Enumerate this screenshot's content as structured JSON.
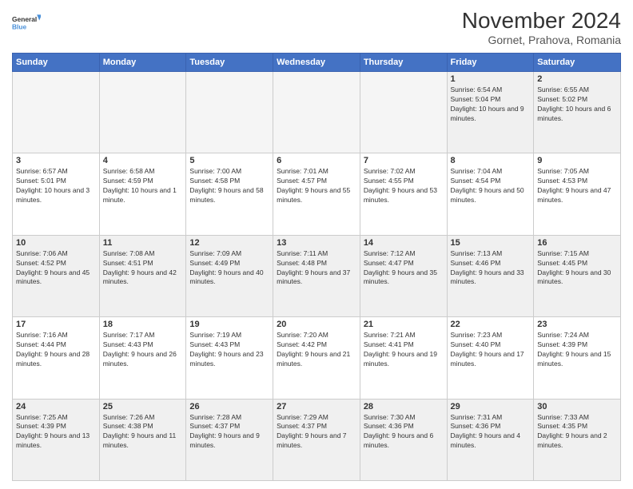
{
  "logo": {
    "general": "General",
    "blue": "Blue"
  },
  "header": {
    "month": "November 2024",
    "location": "Gornet, Prahova, Romania"
  },
  "weekdays": [
    "Sunday",
    "Monday",
    "Tuesday",
    "Wednesday",
    "Thursday",
    "Friday",
    "Saturday"
  ],
  "weeks": [
    [
      {
        "day": "",
        "info": ""
      },
      {
        "day": "",
        "info": ""
      },
      {
        "day": "",
        "info": ""
      },
      {
        "day": "",
        "info": ""
      },
      {
        "day": "",
        "info": ""
      },
      {
        "day": "1",
        "info": "Sunrise: 6:54 AM\nSunset: 5:04 PM\nDaylight: 10 hours and 9 minutes."
      },
      {
        "day": "2",
        "info": "Sunrise: 6:55 AM\nSunset: 5:02 PM\nDaylight: 10 hours and 6 minutes."
      }
    ],
    [
      {
        "day": "3",
        "info": "Sunrise: 6:57 AM\nSunset: 5:01 PM\nDaylight: 10 hours and 3 minutes."
      },
      {
        "day": "4",
        "info": "Sunrise: 6:58 AM\nSunset: 4:59 PM\nDaylight: 10 hours and 1 minute."
      },
      {
        "day": "5",
        "info": "Sunrise: 7:00 AM\nSunset: 4:58 PM\nDaylight: 9 hours and 58 minutes."
      },
      {
        "day": "6",
        "info": "Sunrise: 7:01 AM\nSunset: 4:57 PM\nDaylight: 9 hours and 55 minutes."
      },
      {
        "day": "7",
        "info": "Sunrise: 7:02 AM\nSunset: 4:55 PM\nDaylight: 9 hours and 53 minutes."
      },
      {
        "day": "8",
        "info": "Sunrise: 7:04 AM\nSunset: 4:54 PM\nDaylight: 9 hours and 50 minutes."
      },
      {
        "day": "9",
        "info": "Sunrise: 7:05 AM\nSunset: 4:53 PM\nDaylight: 9 hours and 47 minutes."
      }
    ],
    [
      {
        "day": "10",
        "info": "Sunrise: 7:06 AM\nSunset: 4:52 PM\nDaylight: 9 hours and 45 minutes."
      },
      {
        "day": "11",
        "info": "Sunrise: 7:08 AM\nSunset: 4:51 PM\nDaylight: 9 hours and 42 minutes."
      },
      {
        "day": "12",
        "info": "Sunrise: 7:09 AM\nSunset: 4:49 PM\nDaylight: 9 hours and 40 minutes."
      },
      {
        "day": "13",
        "info": "Sunrise: 7:11 AM\nSunset: 4:48 PM\nDaylight: 9 hours and 37 minutes."
      },
      {
        "day": "14",
        "info": "Sunrise: 7:12 AM\nSunset: 4:47 PM\nDaylight: 9 hours and 35 minutes."
      },
      {
        "day": "15",
        "info": "Sunrise: 7:13 AM\nSunset: 4:46 PM\nDaylight: 9 hours and 33 minutes."
      },
      {
        "day": "16",
        "info": "Sunrise: 7:15 AM\nSunset: 4:45 PM\nDaylight: 9 hours and 30 minutes."
      }
    ],
    [
      {
        "day": "17",
        "info": "Sunrise: 7:16 AM\nSunset: 4:44 PM\nDaylight: 9 hours and 28 minutes."
      },
      {
        "day": "18",
        "info": "Sunrise: 7:17 AM\nSunset: 4:43 PM\nDaylight: 9 hours and 26 minutes."
      },
      {
        "day": "19",
        "info": "Sunrise: 7:19 AM\nSunset: 4:43 PM\nDaylight: 9 hours and 23 minutes."
      },
      {
        "day": "20",
        "info": "Sunrise: 7:20 AM\nSunset: 4:42 PM\nDaylight: 9 hours and 21 minutes."
      },
      {
        "day": "21",
        "info": "Sunrise: 7:21 AM\nSunset: 4:41 PM\nDaylight: 9 hours and 19 minutes."
      },
      {
        "day": "22",
        "info": "Sunrise: 7:23 AM\nSunset: 4:40 PM\nDaylight: 9 hours and 17 minutes."
      },
      {
        "day": "23",
        "info": "Sunrise: 7:24 AM\nSunset: 4:39 PM\nDaylight: 9 hours and 15 minutes."
      }
    ],
    [
      {
        "day": "24",
        "info": "Sunrise: 7:25 AM\nSunset: 4:39 PM\nDaylight: 9 hours and 13 minutes."
      },
      {
        "day": "25",
        "info": "Sunrise: 7:26 AM\nSunset: 4:38 PM\nDaylight: 9 hours and 11 minutes."
      },
      {
        "day": "26",
        "info": "Sunrise: 7:28 AM\nSunset: 4:37 PM\nDaylight: 9 hours and 9 minutes."
      },
      {
        "day": "27",
        "info": "Sunrise: 7:29 AM\nSunset: 4:37 PM\nDaylight: 9 hours and 7 minutes."
      },
      {
        "day": "28",
        "info": "Sunrise: 7:30 AM\nSunset: 4:36 PM\nDaylight: 9 hours and 6 minutes."
      },
      {
        "day": "29",
        "info": "Sunrise: 7:31 AM\nSunset: 4:36 PM\nDaylight: 9 hours and 4 minutes."
      },
      {
        "day": "30",
        "info": "Sunrise: 7:33 AM\nSunset: 4:35 PM\nDaylight: 9 hours and 2 minutes."
      }
    ]
  ]
}
